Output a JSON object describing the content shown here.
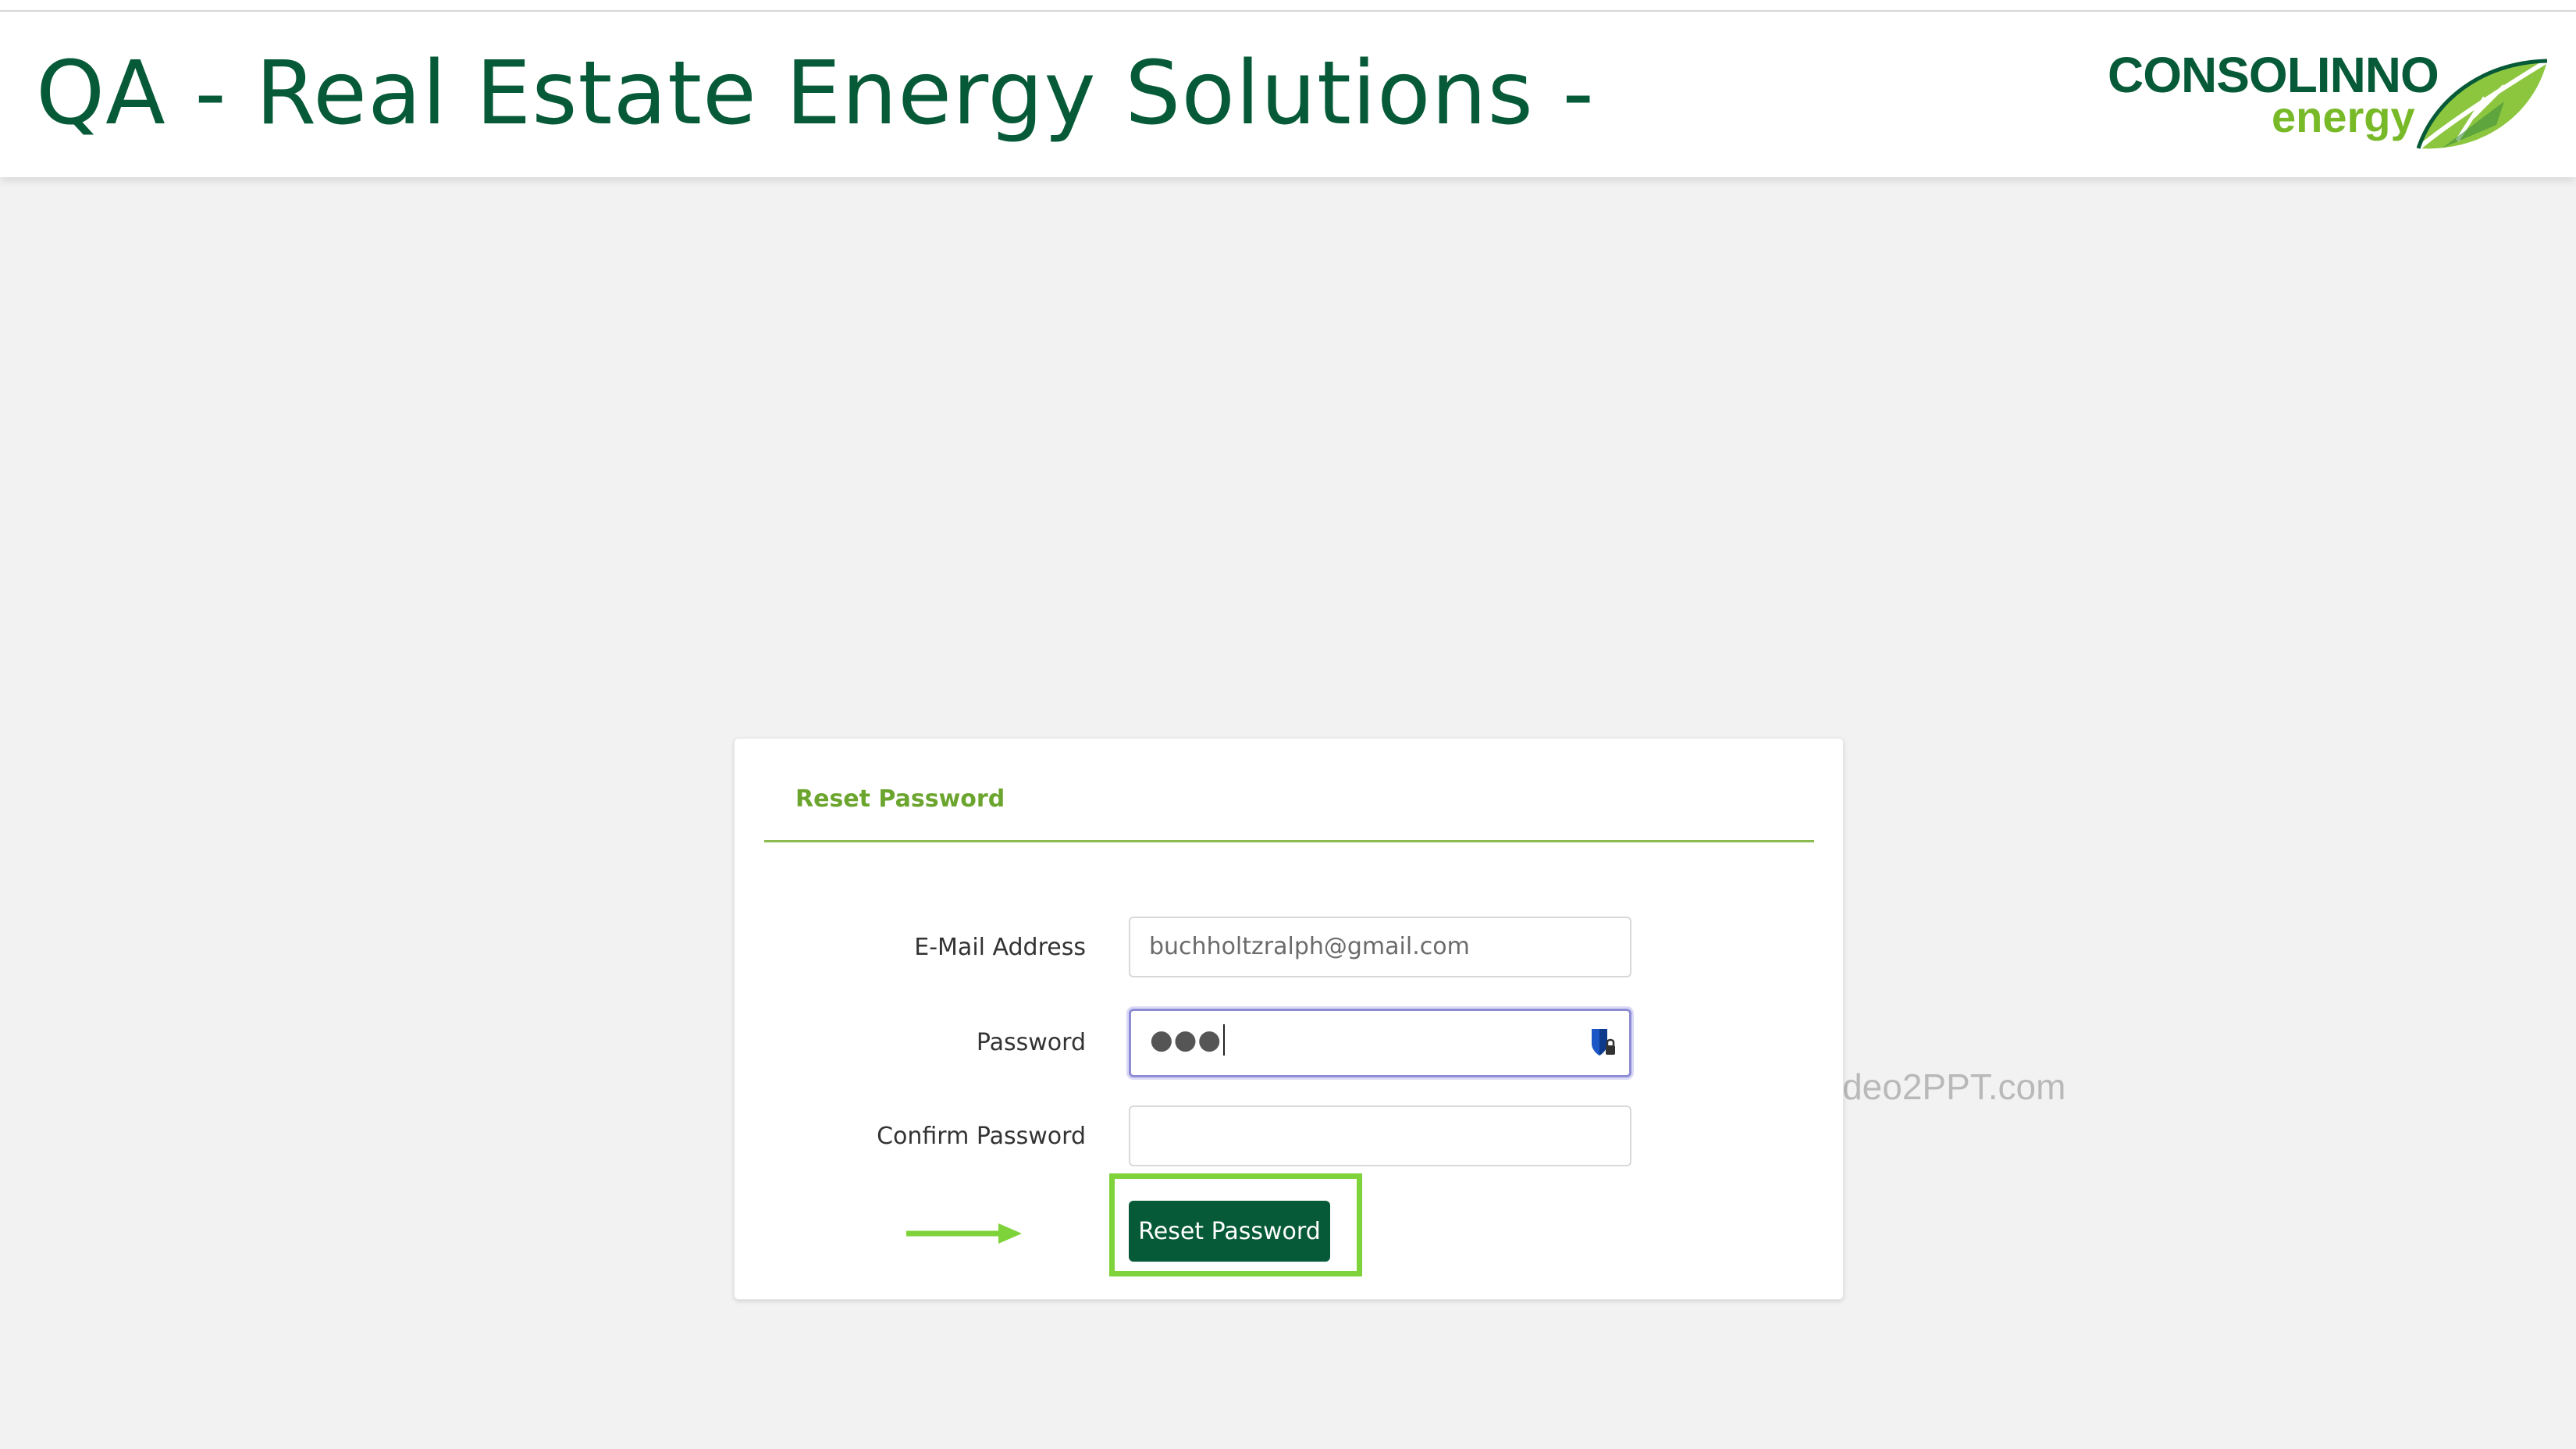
{
  "header": {
    "title": "QA - Real Estate Energy Solutions -",
    "logo_text": "CONSOLINNO",
    "logo_subtext": "energy"
  },
  "reset_form": {
    "title": "Reset Password",
    "email": {
      "label": "E-Mail Address",
      "value": "buchholtzralph@gmail.com"
    },
    "password": {
      "label": "Password",
      "masked_value": "●●●",
      "manager_icon": "password-manager-icon"
    },
    "confirm_password": {
      "label": "Confirm Password",
      "value": ""
    },
    "submit_label": "Reset Password"
  },
  "annotations": {
    "watermark": "Video2PPT.com",
    "highlight_color": "#7fd33a"
  },
  "colors": {
    "brand_dark_green": "#075a38",
    "brand_light_green": "#78b928",
    "focus_ring": "#8f8cd6"
  }
}
